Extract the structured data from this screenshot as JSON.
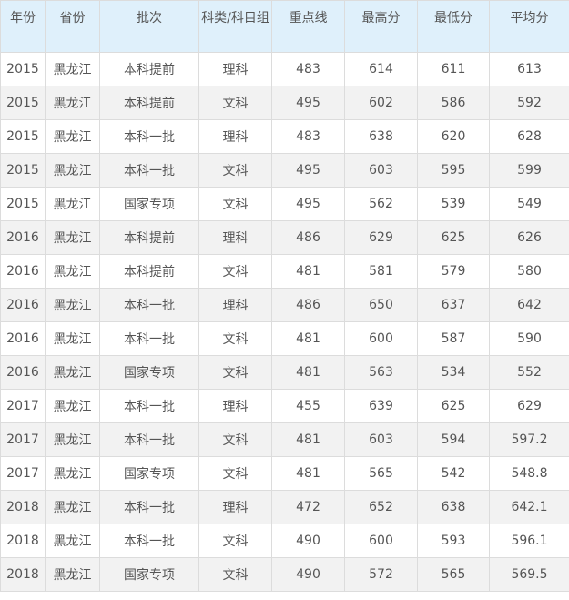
{
  "table": {
    "headers": [
      "年份",
      "省份",
      "批次",
      "科类/科目组",
      "重点线",
      "最高分",
      "最低分",
      "平均分"
    ],
    "rows": [
      [
        "2015",
        "黑龙江",
        "本科提前",
        "理科",
        "483",
        "614",
        "611",
        "613"
      ],
      [
        "2015",
        "黑龙江",
        "本科提前",
        "文科",
        "495",
        "602",
        "586",
        "592"
      ],
      [
        "2015",
        "黑龙江",
        "本科一批",
        "理科",
        "483",
        "638",
        "620",
        "628"
      ],
      [
        "2015",
        "黑龙江",
        "本科一批",
        "文科",
        "495",
        "603",
        "595",
        "599"
      ],
      [
        "2015",
        "黑龙江",
        "国家专项",
        "文科",
        "495",
        "562",
        "539",
        "549"
      ],
      [
        "2016",
        "黑龙江",
        "本科提前",
        "理科",
        "486",
        "629",
        "625",
        "626"
      ],
      [
        "2016",
        "黑龙江",
        "本科提前",
        "文科",
        "481",
        "581",
        "579",
        "580"
      ],
      [
        "2016",
        "黑龙江",
        "本科一批",
        "理科",
        "486",
        "650",
        "637",
        "642"
      ],
      [
        "2016",
        "黑龙江",
        "本科一批",
        "文科",
        "481",
        "600",
        "587",
        "590"
      ],
      [
        "2016",
        "黑龙江",
        "国家专项",
        "文科",
        "481",
        "563",
        "534",
        "552"
      ],
      [
        "2017",
        "黑龙江",
        "本科一批",
        "理科",
        "455",
        "639",
        "625",
        "629"
      ],
      [
        "2017",
        "黑龙江",
        "本科一批",
        "文科",
        "481",
        "603",
        "594",
        "597.2"
      ],
      [
        "2017",
        "黑龙江",
        "国家专项",
        "文科",
        "481",
        "565",
        "542",
        "548.8"
      ],
      [
        "2018",
        "黑龙江",
        "本科一批",
        "理科",
        "472",
        "652",
        "638",
        "642.1"
      ],
      [
        "2018",
        "黑龙江",
        "本科一批",
        "文科",
        "490",
        "600",
        "593",
        "596.1"
      ],
      [
        "2018",
        "黑龙江",
        "国家专项",
        "文科",
        "490",
        "572",
        "565",
        "569.5"
      ]
    ]
  }
}
